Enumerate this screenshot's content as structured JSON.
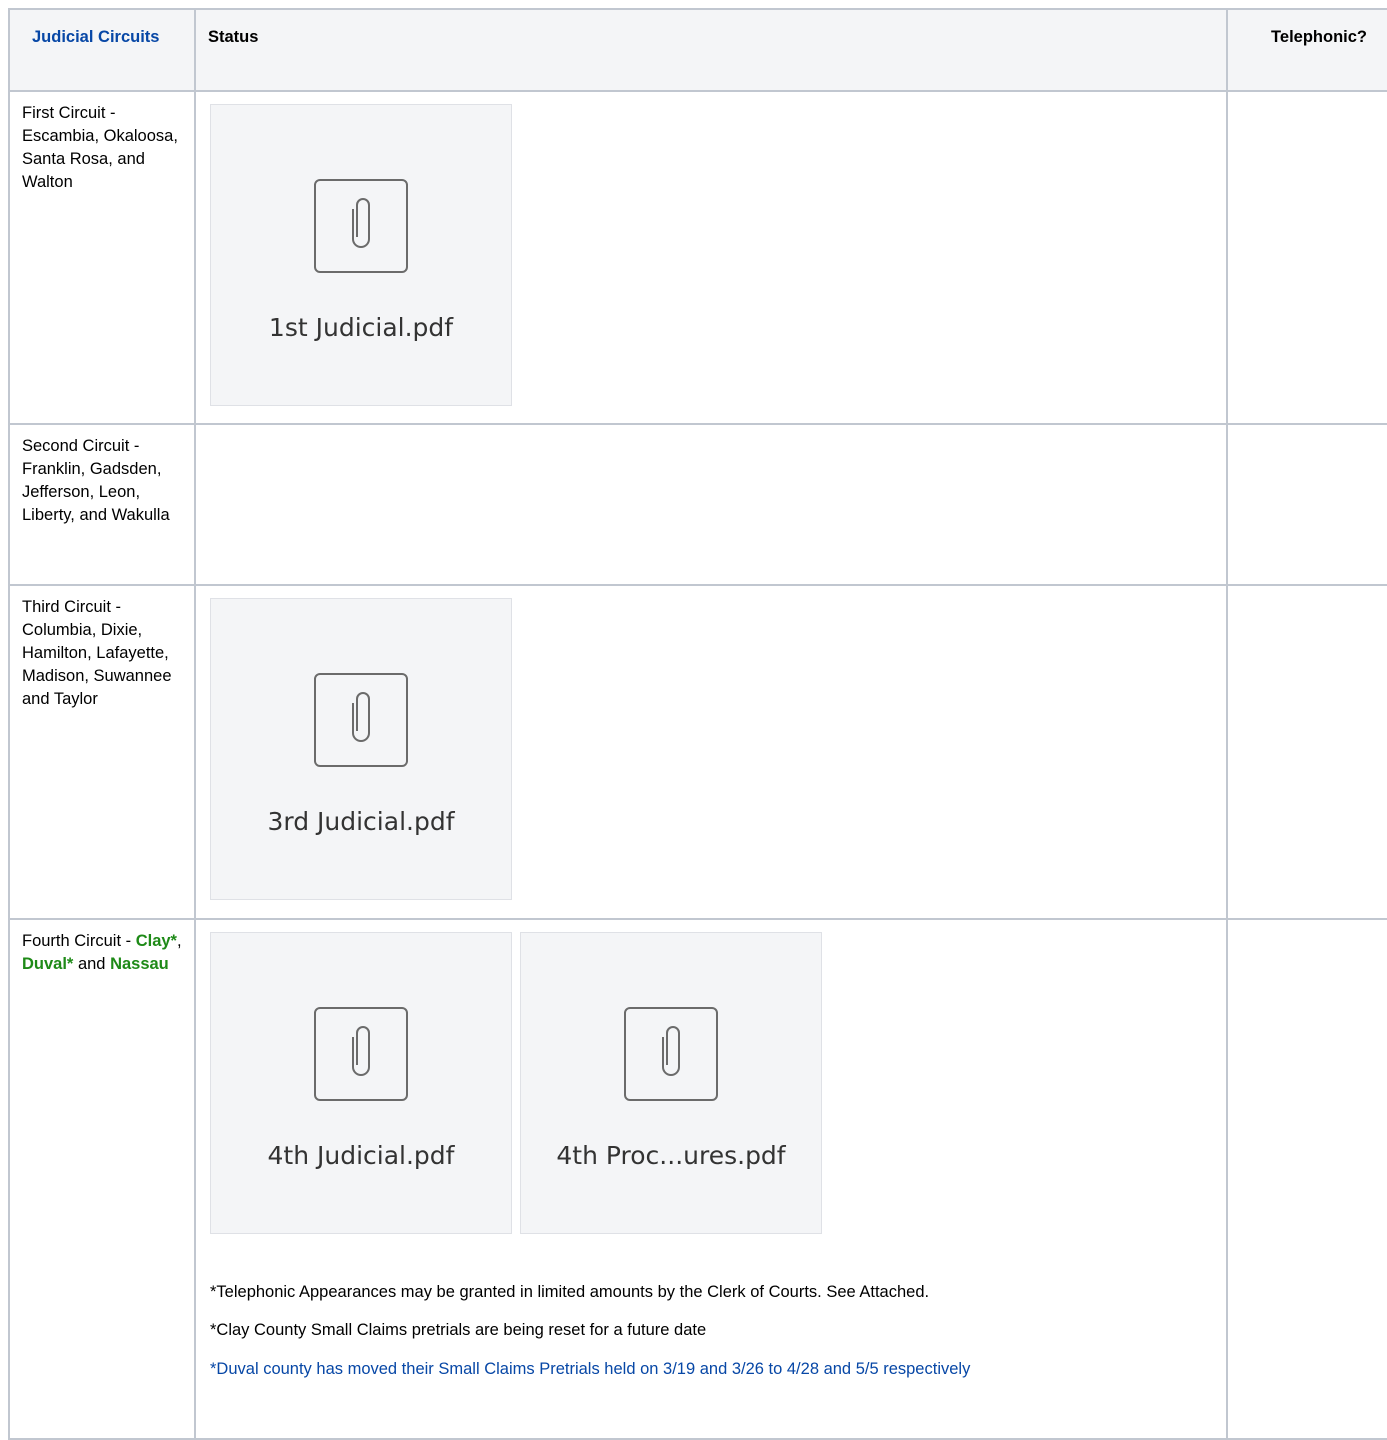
{
  "header": {
    "col1": "Judicial Circuits",
    "col2": "Status",
    "col3": "Telephonic?"
  },
  "rows": [
    {
      "circuit": "First Circuit - Escambia, Okaloosa, Santa Rosa, and Walton",
      "attachments": [
        "1st Judicial.pdf"
      ]
    },
    {
      "circuit": "Second Circuit - Franklin, Gadsden, Jefferson, Leon, Liberty, and Wakulla"
    },
    {
      "circuit": "Third Circuit - Columbia, Dixie, Hamilton, Lafayette, Madison, Suwannee and Taylor",
      "attachments": [
        "3rd Judicial.pdf"
      ]
    },
    {
      "circuit_prefix": "Fourth Circuit - ",
      "circuit_links": [
        "Clay*",
        "Duval*",
        "Nassau"
      ],
      "circuit_sep1": ", ",
      "circuit_sep2": " and ",
      "attachments": [
        "4th Judicial.pdf",
        "4th Proc...ures.pdf"
      ],
      "notes": [
        "*Telephonic Appearances may be granted in limited amounts by the Clerk of Courts. See Attached.",
        "*Clay County Small Claims pretrials are being reset for a future date",
        "*Duval county has moved their Small Claims Pretrials held on 3/19 and 3/26 to 4/28 and 5/5 respectively"
      ]
    }
  ],
  "colors": {
    "link_green": "#1e8a17",
    "header_blue": "#0747a6",
    "border": "#c1c7d0"
  }
}
